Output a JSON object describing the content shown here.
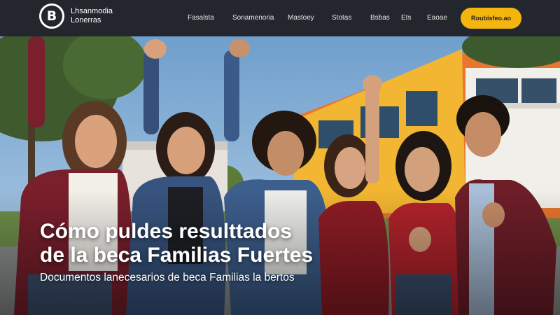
{
  "header": {
    "logo_letter": "B",
    "logo_line1": "Lhsanmodia",
    "logo_line2": "Lonerras",
    "nav": [
      "Fasalsta",
      "Sonamenoria",
      "Mastoey",
      "Stotas",
      "Bsbas",
      "Ets",
      "Eaoae"
    ],
    "cta_label": "Roubisfeo.ao"
  },
  "hero": {
    "headline_line1": "Cómo puldes resulttados",
    "headline_line2": "de la beca Familias Fuertes",
    "subline": "Documentos lanecesarios de beca Familias la bertos"
  },
  "colors": {
    "header_bg": "#23262d",
    "cta_bg": "#f5b50f",
    "building_yellow": "#f2b632",
    "building_orange": "#e8762f",
    "sky": "#8fb7d8"
  }
}
